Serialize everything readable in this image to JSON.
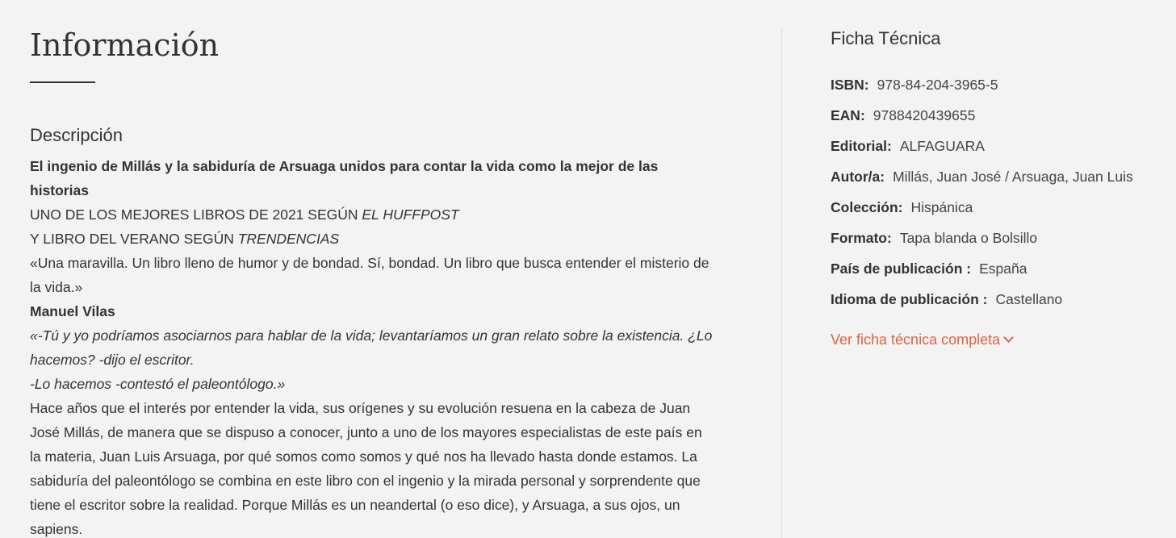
{
  "info": {
    "heading": "Información"
  },
  "description": {
    "title": "Descripción",
    "lead_bold": "El ingenio de Millás y la sabiduría de Arsuaga unidos para contar la vida como la mejor de las historias",
    "line1_text": "UNO DE LOS MEJORES LIBROS DE 2021 SEGÚN ",
    "line1_source": "EL HUFFPOST",
    "line2_text": "Y LIBRO DEL VERANO SEGÚN ",
    "line2_source": "TRENDENCIAS",
    "quote": "«Una maravilla. Un libro lleno de humor y de bondad. Sí, bondad. Un libro que busca entender el misterio de la vida.»",
    "quote_author": "Manuel Vilas",
    "dialogue1": "«-Tú y yo podríamos asociarnos para hablar de la vida; levantaríamos un gran relato sobre la existencia. ¿Lo hacemos? -dijo el escritor.",
    "dialogue2": "-Lo hacemos -contestó el paleontólogo.»",
    "paragraph": "Hace años que el interés por entender la vida, sus orígenes y su evolución resuena en la cabeza de Juan José Millás, de manera que se dispuso a conocer, junto a uno de los mayores especialistas de este país en la materia, Juan Luis Arsuaga, por qué somos como somos y qué nos ha llevado hasta donde estamos. La sabiduría del paleontólogo se combina en este libro con el ingenio y la mirada personal y sorprendente que tiene el escritor sobre la realidad. Porque Millás es un neandertal (o eso dice), y Arsuaga, a sus ojos, un sapiens."
  },
  "ficha": {
    "title": "Ficha Técnica",
    "rows": [
      {
        "label": "ISBN:",
        "value": "978-84-204-3965-5"
      },
      {
        "label": "EAN:",
        "value": "9788420439655"
      },
      {
        "label": "Editorial:",
        "value": "ALFAGUARA"
      },
      {
        "label": "Autor/a:",
        "value": "Millás, Juan José / Arsuaga, Juan Luis"
      },
      {
        "label": "Colección:",
        "value": "Hispánica"
      },
      {
        "label": "Formato:",
        "value": "Tapa blanda o Bolsillo"
      },
      {
        "label": "País de publicación :",
        "value": "España"
      },
      {
        "label": "Idioma de publicación :",
        "value": "Castellano"
      }
    ],
    "more_link": "Ver ficha técnica completa",
    "more_icon": "chevron-down-icon"
  },
  "colors": {
    "background": "#f3f3f3",
    "text": "#333333",
    "accent_link": "#e0633f",
    "divider": "#dddddd"
  }
}
